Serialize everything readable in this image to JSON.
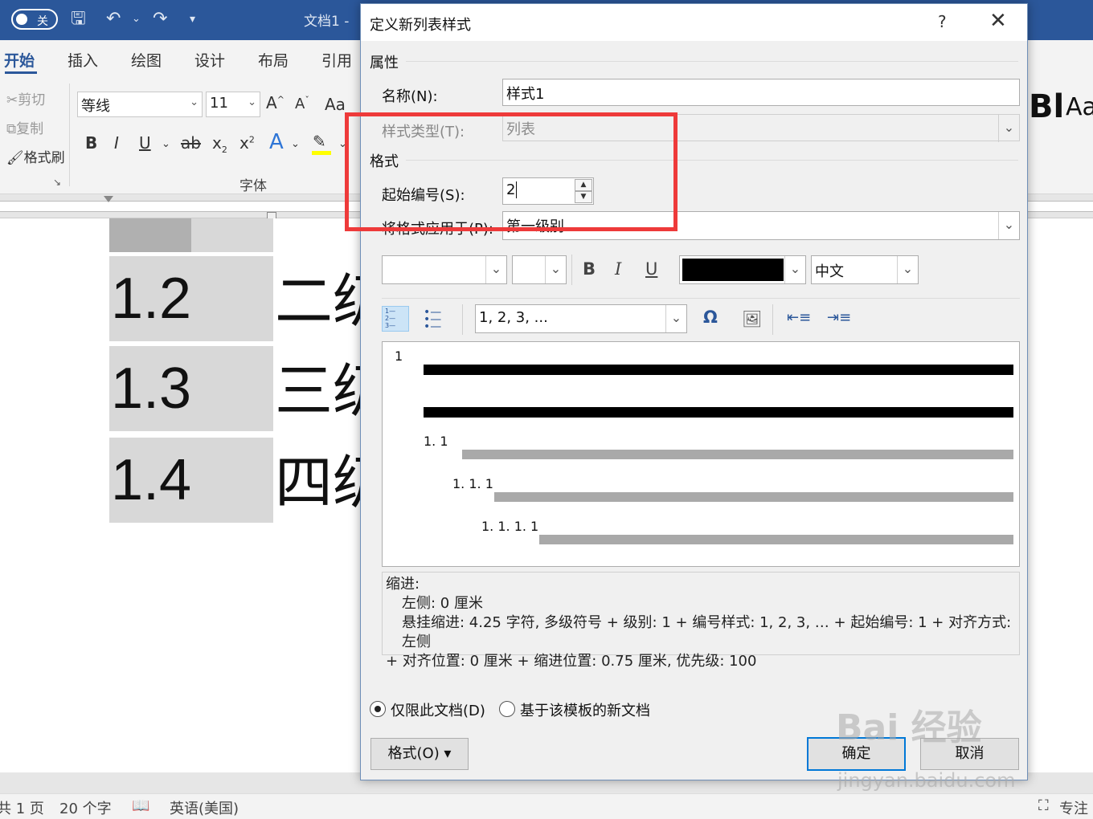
{
  "titlebar": {
    "autosave_label": "关",
    "doc_title": "文档1 -"
  },
  "ribbon": {
    "tabs": [
      "开始",
      "插入",
      "绘图",
      "设计",
      "布局",
      "引用"
    ],
    "clipboard": [
      "剪切",
      "复制",
      "格式刷"
    ],
    "font_name": "等线",
    "font_size": "11",
    "font_group_label": "字体",
    "change_case": "Aa",
    "styles_peek": [
      "Bl",
      "Aa"
    ]
  },
  "document": {
    "rows": [
      {
        "num": "1.2",
        "text": "二级"
      },
      {
        "num": "1.3",
        "text": "三级"
      },
      {
        "num": "1.4",
        "text": "四级"
      }
    ]
  },
  "statusbar": {
    "page": "共 1 页",
    "words": "20 个字",
    "language": "英语(美国)",
    "focus": "专注"
  },
  "dialog": {
    "title": "定义新列表样式",
    "help": "?",
    "close": "✕",
    "properties_label": "属性",
    "name_label": "名称(N):",
    "name_value": "样式1",
    "style_type_label": "样式类型(T):",
    "style_type_value": "列表",
    "format_label": "格式",
    "start_at_label": "起始编号(S):",
    "start_at_value": "2",
    "apply_to_label": "将格式应用于(P):",
    "apply_to_value": "第一级别",
    "font_lang": "中文",
    "number_style": "1, 2, 3, ...",
    "preview_levels": [
      "1",
      "1. 1",
      "1. 1. 1",
      "1. 1. 1. 1"
    ],
    "description_title": "缩进:",
    "description_line1": "左侧:  0 厘米",
    "description_line2": "悬挂缩进: 4.25 字符, 多级符号 + 级别: 1 + 编号样式: 1, 2, 3, … + 起始编号: 1 + 对齐方式: 左侧",
    "description_line3": "+ 对齐位置:  0 厘米 + 缩进位置:  0.75 厘米, 优先级: 100",
    "radio_this_doc": "仅限此文档(D)",
    "radio_template": "基于该模板的新文档",
    "format_button": "格式(O) ▾",
    "ok_button": "确定",
    "cancel_button": "取消"
  },
  "watermark": {
    "main": "Bai 经验",
    "sub": "jingyan.baidu.com"
  },
  "colors": {
    "word_blue": "#2b579a",
    "highlight_red": "#ee3a3a",
    "dialog_bg": "#f0f0f0"
  }
}
